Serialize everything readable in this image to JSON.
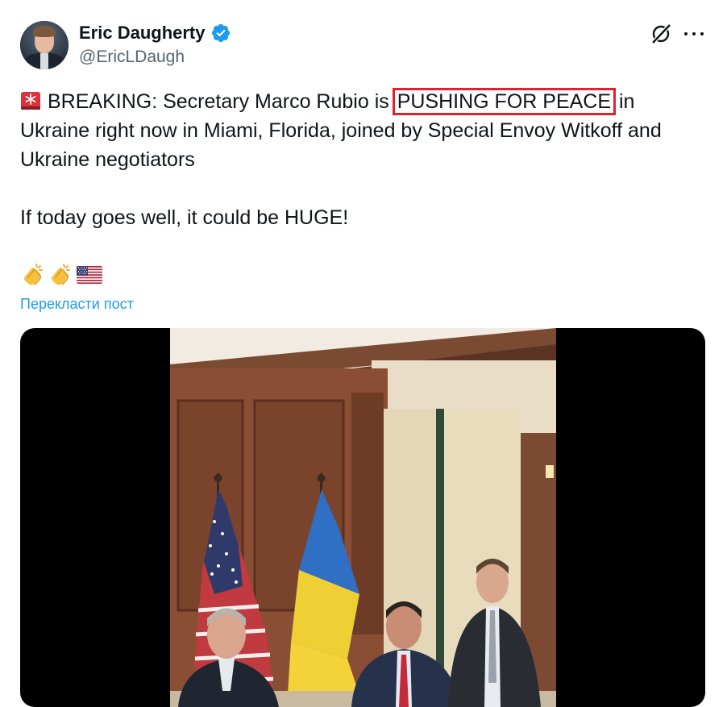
{
  "author": {
    "name": "Eric Daugherty",
    "handle": "@EricLDaugh",
    "verified": true,
    "verified_color": "#1d9bf0"
  },
  "icons": {
    "verified": "verified-badge-icon",
    "grok": "grok-icon",
    "more": "more-options-icon",
    "siren": "rotating-light-emoji",
    "clap": "clapping-hands-emoji",
    "flag": "us-flag-emoji"
  },
  "tweet": {
    "line1_before": "BREAKING: Secretary Marco Rubio is ",
    "highlighted": "PUSHING FOR PEACE",
    "line1_after": " in",
    "line2": "Ukraine right now in Miami, Florida, joined by Special Envoy Witkoff and",
    "line3": "Ukraine negotiators",
    "line4": "If today goes well, it could be HUGE!",
    "highlight_color": "#e0222f"
  },
  "translate_label": "Перекласти пост",
  "link_color": "#1d9bf0"
}
